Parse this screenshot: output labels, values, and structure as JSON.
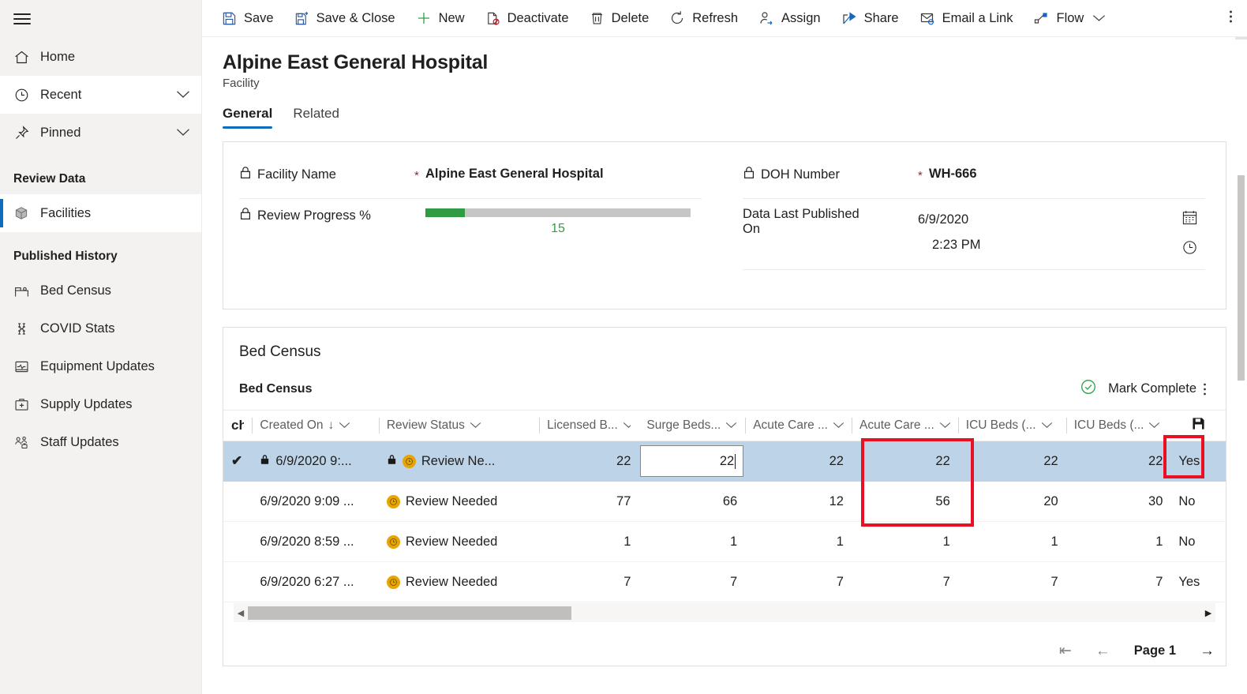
{
  "sidebar": {
    "hamburger": "menu-icon",
    "top_items": [
      {
        "label": "Home",
        "icon": "home-icon",
        "chevron": "",
        "state": "default"
      },
      {
        "label": "Recent",
        "icon": "clock-icon",
        "chevron": "⌄",
        "state": "white"
      },
      {
        "label": "Pinned",
        "icon": "pin-icon",
        "chevron": "⌄",
        "state": "default"
      }
    ],
    "group1_title": "Review Data",
    "group1_items": [
      {
        "label": "Facilities",
        "icon": "cube-icon",
        "selected": true
      }
    ],
    "group2_title": "Published History",
    "group2_items": [
      {
        "label": "Bed Census",
        "icon": "bed-icon"
      },
      {
        "label": "COVID Stats",
        "icon": "virus-icon"
      },
      {
        "label": "Equipment Updates",
        "icon": "monitor-icon"
      },
      {
        "label": "Supply Updates",
        "icon": "medkit-icon"
      },
      {
        "label": "Staff Updates",
        "icon": "people-icon"
      }
    ]
  },
  "commandbar": {
    "items": [
      {
        "label": "Save",
        "icon": "save-icon"
      },
      {
        "label": "Save & Close",
        "icon": "save-close-icon"
      },
      {
        "label": "New",
        "icon": "plus-icon"
      },
      {
        "label": "Deactivate",
        "icon": "deactivate-icon"
      },
      {
        "label": "Delete",
        "icon": "trash-icon"
      },
      {
        "label": "Refresh",
        "icon": "refresh-icon"
      },
      {
        "label": "Assign",
        "icon": "assign-person-icon"
      },
      {
        "label": "Share",
        "icon": "share-icon"
      },
      {
        "label": "Email a Link",
        "icon": "email-link-icon"
      },
      {
        "label": "Flow",
        "icon": "flow-icon"
      }
    ],
    "flow_caret": "⌄",
    "overflow": "more-commands-icon"
  },
  "record": {
    "title": "Alpine East General Hospital",
    "subtitle": "Facility"
  },
  "tabs": [
    {
      "label": "General",
      "active": true
    },
    {
      "label": "Related",
      "active": false
    }
  ],
  "form": {
    "facility_name": {
      "label": "Facility Name",
      "required": "*",
      "value": "Alpine East General Hospital",
      "lock": "lock-icon"
    },
    "review_progress": {
      "label": "Review Progress %",
      "value": "15",
      "percent": 15,
      "lock": "lock-icon",
      "fill_color": "#309b42",
      "track_color": "#c8c6c4",
      "text_color": "#3a9b48"
    },
    "doh_number": {
      "label": "DOH Number",
      "required": "*",
      "value": "WH-666",
      "lock": "lock-icon"
    },
    "data_last_published": {
      "label": "Data Last Published On",
      "label_line1": "Data Last Published",
      "label_line2": "On",
      "date": "6/9/2020",
      "time": "2:23 PM",
      "date_icon": "calendar-icon",
      "time_icon": "clock-icon"
    }
  },
  "grid": {
    "section_title": "Bed Census",
    "subgrid_title": "Bed Census",
    "mark_complete": "Mark Complete",
    "mark_complete_icon": "check-circle-icon",
    "kebab_icon": "more-vertical-icon",
    "save_row_icon": "save-icon",
    "columns": [
      {
        "label": "",
        "icon": "checkmark-icon",
        "sort": ""
      },
      {
        "label": "Created On",
        "sort": "↓",
        "caret": "⌄"
      },
      {
        "label": "Review Status",
        "caret": "⌄"
      },
      {
        "label": "Licensed B...",
        "caret": "⌄"
      },
      {
        "label": "Surge Beds...",
        "caret": "⌄"
      },
      {
        "label": "Acute Care ...",
        "caret": "⌄"
      },
      {
        "label": "Acute Care ...",
        "caret": "⌄"
      },
      {
        "label": "ICU Beds (...",
        "caret": "⌄"
      },
      {
        "label": "ICU Beds (...",
        "caret": "⌄"
      }
    ],
    "rows": [
      {
        "selected": true,
        "checked": "✔",
        "locked": true,
        "created_on": "6/9/2020 9:...",
        "status_lock": true,
        "status_icon": "clock-badge-icon",
        "review_status": "Review Ne...",
        "licensed_beds": "22",
        "surge_beds": "22",
        "surge_beds_editing": true,
        "acute_care_1": "22",
        "acute_care_2": "22",
        "icu_beds_1": "22",
        "icu_beds_2": "22",
        "last": "Yes"
      },
      {
        "selected": false,
        "checked": "",
        "locked": false,
        "created_on": "6/9/2020 9:09 ...",
        "status_lock": false,
        "status_icon": "clock-badge-icon",
        "review_status": "Review Needed",
        "licensed_beds": "77",
        "surge_beds": "66",
        "surge_beds_editing": false,
        "acute_care_1": "12",
        "acute_care_2": "56",
        "icu_beds_1": "20",
        "icu_beds_2": "30",
        "last": "No"
      },
      {
        "selected": false,
        "checked": "",
        "locked": false,
        "created_on": "6/9/2020 8:59 ...",
        "status_lock": false,
        "status_icon": "clock-badge-icon",
        "review_status": "Review Needed",
        "licensed_beds": "1",
        "surge_beds": "1",
        "surge_beds_editing": false,
        "acute_care_1": "1",
        "acute_care_2": "1",
        "icu_beds_1": "1",
        "icu_beds_2": "1",
        "last": "No"
      },
      {
        "selected": false,
        "checked": "",
        "locked": false,
        "created_on": "6/9/2020 6:27 ...",
        "status_lock": false,
        "status_icon": "clock-badge-icon",
        "review_status": "Review Needed",
        "licensed_beds": "7",
        "surge_beds": "7",
        "surge_beds_editing": false,
        "acute_care_1": "7",
        "acute_care_2": "7",
        "icu_beds_1": "7",
        "icu_beds_2": "7",
        "last": "Yes"
      }
    ],
    "pager": {
      "first": "⇤",
      "prev": "←",
      "page_label": "Page 1",
      "next": "→"
    },
    "hscroll_left": "◀",
    "hscroll_right": "▶"
  },
  "annotations": {
    "accent": "#e81123",
    "boxes": [
      "surge-beds-column-highlight",
      "save-row-button-highlight"
    ]
  }
}
